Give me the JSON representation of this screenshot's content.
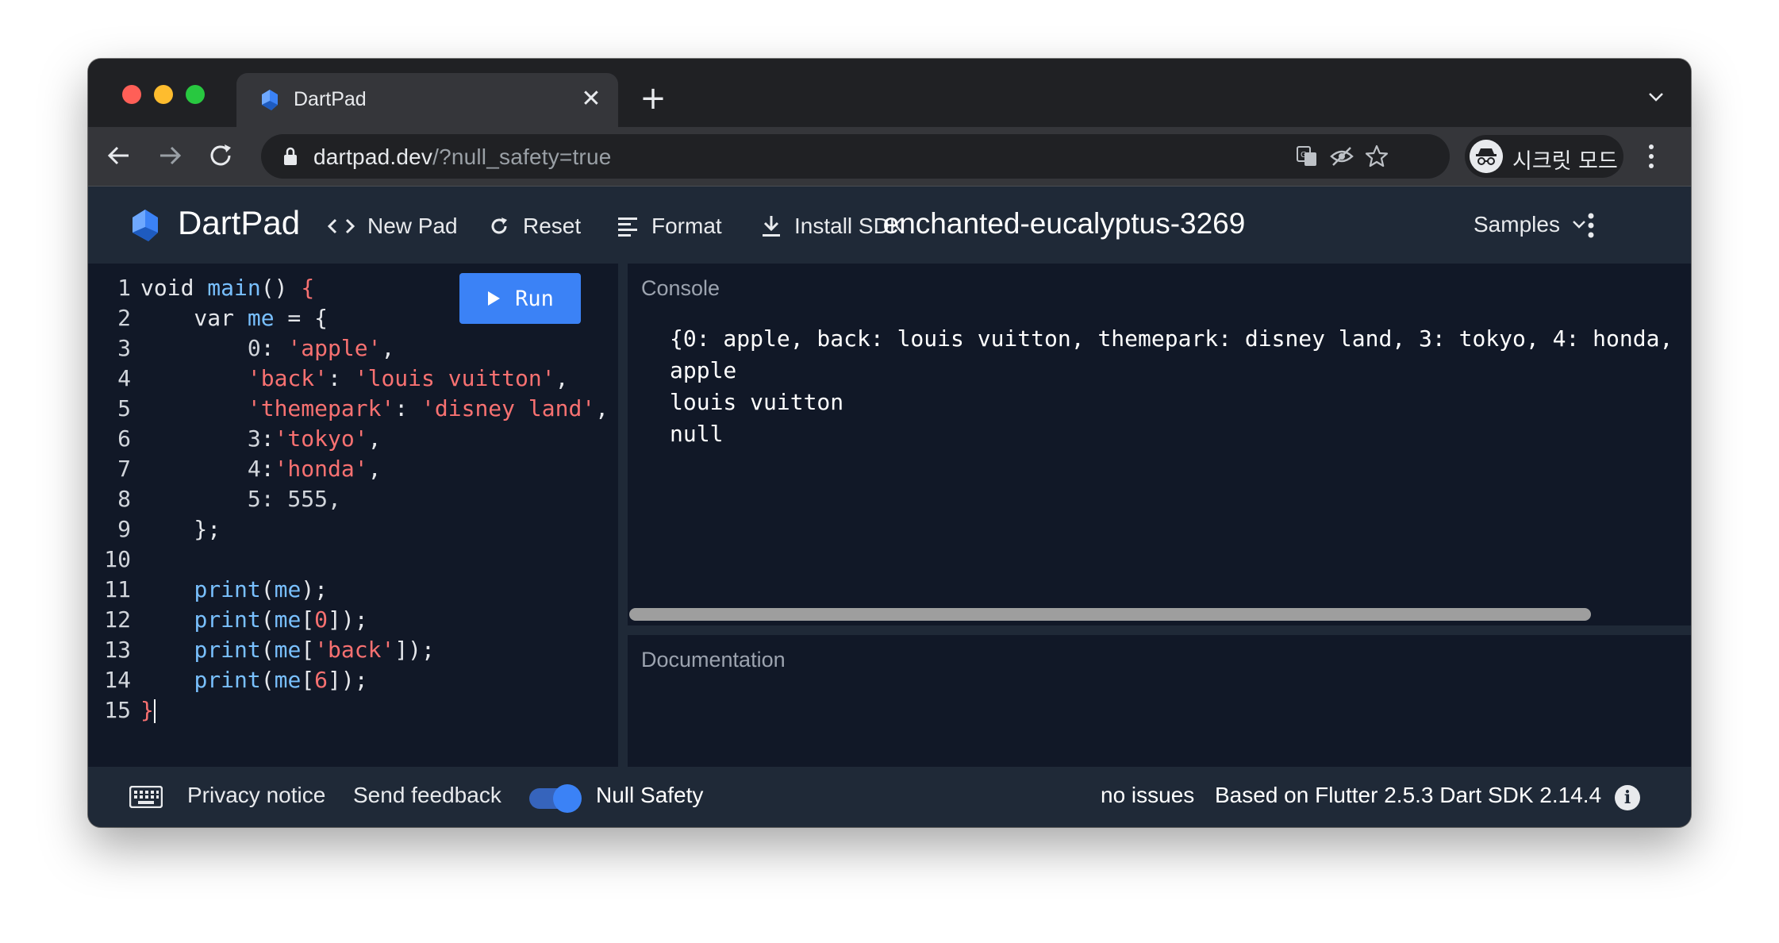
{
  "browser": {
    "tab_title": "DartPad",
    "tab_close": "✕",
    "new_tab": "+",
    "url_host": "dartpad.dev",
    "url_path": "/?null_safety=true",
    "incognito_label": "시크릿 모드"
  },
  "app": {
    "title": "DartPad",
    "toolbar": {
      "new_pad": "New Pad",
      "reset": "Reset",
      "format": "Format",
      "install_sdk": "Install SDK"
    },
    "pad_name": "enchanted-eucalyptus-3269",
    "samples": "Samples"
  },
  "editor": {
    "run_label": "Run",
    "line_numbers": [
      "1",
      "2",
      "3",
      "4",
      "5",
      "6",
      "7",
      "8",
      "9",
      "10",
      "11",
      "12",
      "13",
      "14",
      "15"
    ],
    "tokens": {
      "l1_void": "void ",
      "l1_main": "main",
      "l1_paren": "() ",
      "l1_brace": "{",
      "l2_var": "    var ",
      "l2_me": "me",
      "l2_eq": " = {",
      "l3_key": "        0",
      "l3_colon": ": ",
      "l3_val": "'apple'",
      "l3_comma": ",",
      "l4_key": "        'back'",
      "l4_colon": ": ",
      "l4_val": "'louis vuitton'",
      "l4_comma": ",",
      "l5_key": "        'themepark'",
      "l5_colon": ": ",
      "l5_val": "'disney land'",
      "l5_comma": ",",
      "l6_key": "        3",
      "l6_colon": ":",
      "l6_val": "'tokyo'",
      "l6_comma": ",",
      "l7_key": "        4",
      "l7_colon": ":",
      "l7_val": "'honda'",
      "l7_comma": ",",
      "l8_text": "        5: 555,",
      "l9_text": "    };",
      "l11_indent": "    ",
      "l11_fn": "print",
      "l11_open": "(",
      "l11_arg": "me",
      "l11_close": ");",
      "l12_indent": "    ",
      "l12_fn": "print",
      "l12_open": "(",
      "l12_arg": "me",
      "l12_br": "[",
      "l12_idx": "0",
      "l12_close": "]);",
      "l13_indent": "    ",
      "l13_fn": "print",
      "l13_open": "(",
      "l13_arg": "me",
      "l13_br": "[",
      "l13_idx": "'back'",
      "l13_close": "]);",
      "l14_indent": "    ",
      "l14_fn": "print",
      "l14_open": "(",
      "l14_arg": "me",
      "l14_br": "[",
      "l14_idx": "6",
      "l14_close": "]);",
      "l15_brace": "}"
    }
  },
  "console": {
    "label": "Console",
    "lines": [
      "{0: apple, back: louis vuitton, themepark: disney land, 3: tokyo, 4: honda,",
      "apple",
      "louis vuitton",
      "null"
    ]
  },
  "documentation": {
    "label": "Documentation"
  },
  "footer": {
    "privacy": "Privacy notice",
    "feedback": "Send feedback",
    "null_safety_label": "Null Safety",
    "null_safety_on": true,
    "issues": "no issues",
    "version": "Based on Flutter 2.5.3 Dart SDK 2.14.4",
    "info": "i"
  },
  "colors": {
    "accent": "#3b82f6",
    "header_bg": "#1f2937",
    "editor_bg": "#111827",
    "string": "#f87171",
    "function": "#79c0ff"
  }
}
